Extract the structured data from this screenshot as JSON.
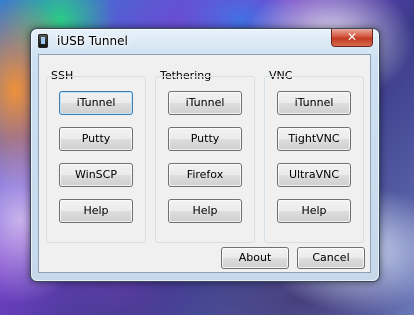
{
  "window": {
    "title": "iUSB Tunnel",
    "close_glyph": "✕"
  },
  "groups": [
    {
      "label": "SSH",
      "buttons": [
        "iTunnel",
        "Putty",
        "WinSCP",
        "Help"
      ]
    },
    {
      "label": "Tethering",
      "buttons": [
        "iTunnel",
        "Putty",
        "Firefox",
        "Help"
      ]
    },
    {
      "label": "VNC",
      "buttons": [
        "iTunnel",
        "TightVNC",
        "UltraVNC",
        "Help"
      ]
    }
  ],
  "footer": {
    "about_label": "About",
    "cancel_label": "Cancel"
  }
}
